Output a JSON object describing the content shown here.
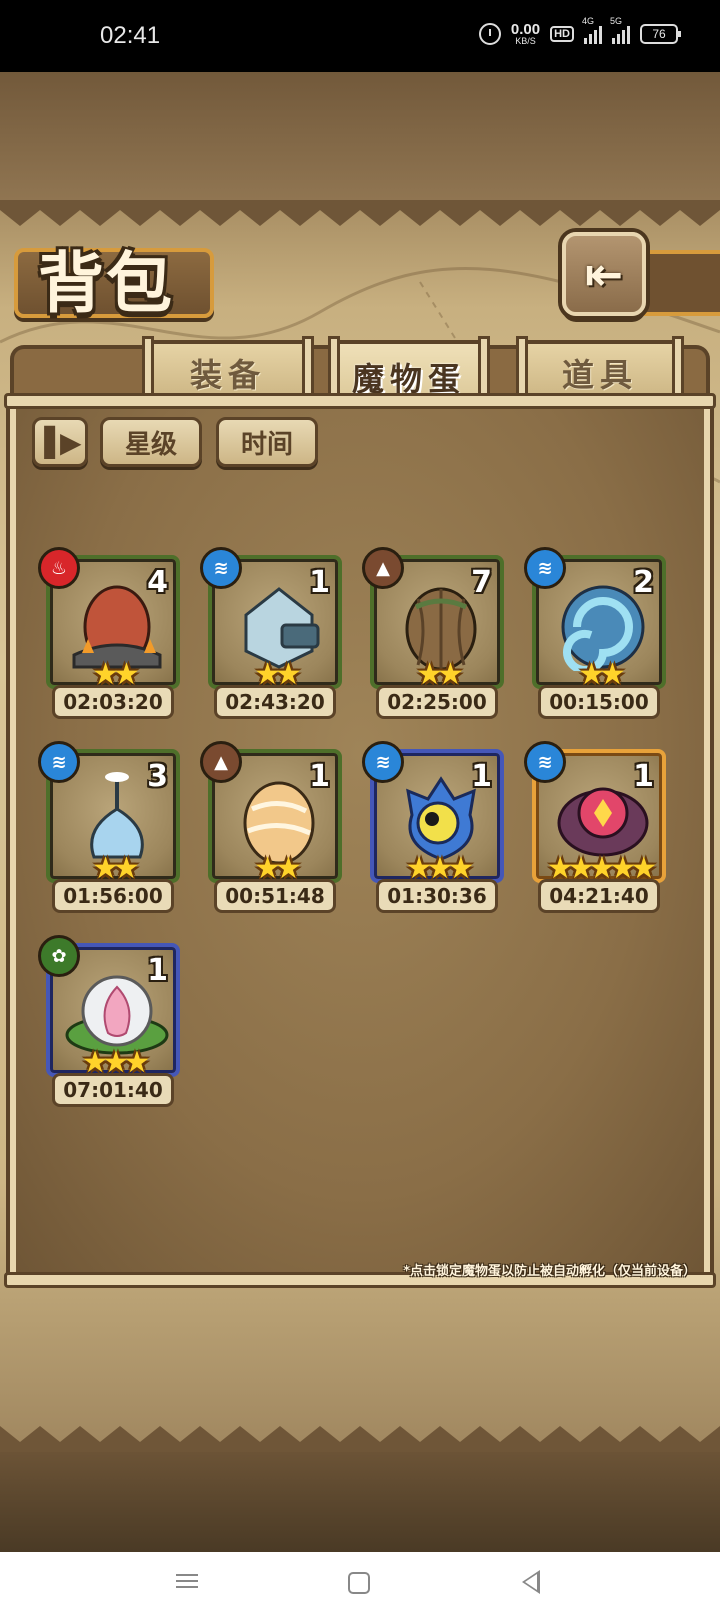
{
  "status_bar": {
    "time": "02:41",
    "net_speed_value": "0.00",
    "net_speed_unit": "KB/S",
    "hd_label": "HD",
    "sig1_label": "4G",
    "sig2_label": "5G",
    "battery": "76"
  },
  "header": {
    "title": "背包",
    "back_icon": "return-arrow-icon"
  },
  "tabs": [
    {
      "label": "装备",
      "active": false
    },
    {
      "label": "魔物蛋",
      "active": true
    },
    {
      "label": "道具",
      "active": false
    }
  ],
  "toolbar": {
    "lock_icon": "pause-lock-icon",
    "sort_star": "星级",
    "sort_time": "时间"
  },
  "eggs": [
    {
      "element": "fire",
      "count": "4",
      "stars": 2,
      "timer": "02:03:20",
      "rarity": "green"
    },
    {
      "element": "water",
      "count": "1",
      "stars": 2,
      "timer": "02:43:20",
      "rarity": "green"
    },
    {
      "element": "earth",
      "count": "7",
      "stars": 2,
      "timer": "02:25:00",
      "rarity": "green"
    },
    {
      "element": "water",
      "count": "2",
      "stars": 2,
      "timer": "00:15:00",
      "rarity": "green"
    },
    {
      "element": "water",
      "count": "3",
      "stars": 2,
      "timer": "01:56:00",
      "rarity": "green"
    },
    {
      "element": "earth",
      "count": "1",
      "stars": 2,
      "timer": "00:51:48",
      "rarity": "green"
    },
    {
      "element": "water",
      "count": "1",
      "stars": 3,
      "timer": "01:30:36",
      "rarity": "blue"
    },
    {
      "element": "water",
      "count": "1",
      "stars": 5,
      "timer": "04:21:40",
      "rarity": "gold"
    },
    {
      "element": "grass",
      "count": "1",
      "stars": 3,
      "timer": "07:01:40",
      "rarity": "blue"
    }
  ],
  "note": "*点击锁定魔物蛋以防止被自动孵化（仅当前设备）",
  "nav": {
    "menu_icon": "menu-icon",
    "home_icon": "home-icon",
    "back_icon": "back-icon"
  }
}
